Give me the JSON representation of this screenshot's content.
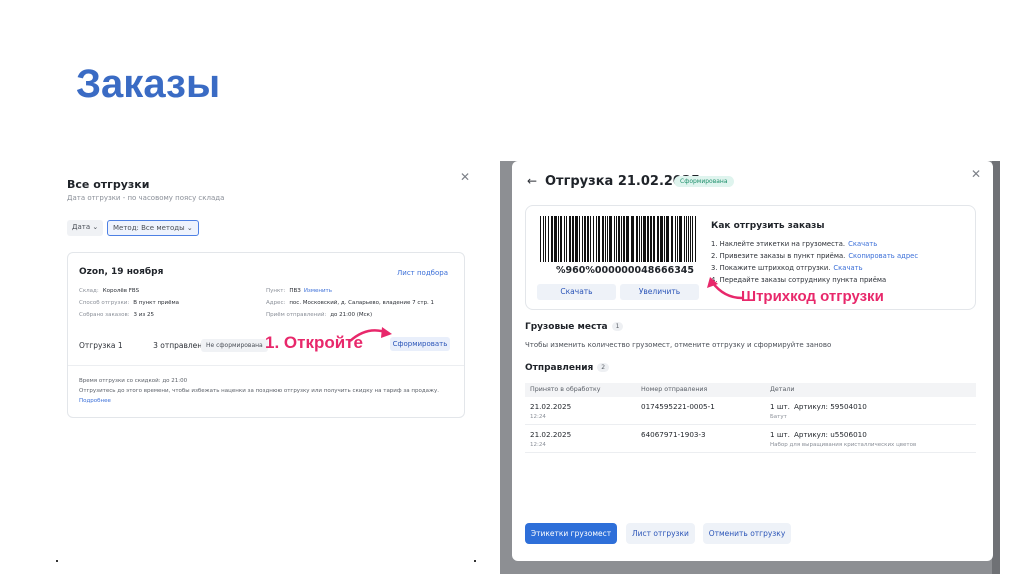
{
  "slide": {
    "title": "Заказы"
  },
  "left": {
    "title": "Все отгрузки",
    "subtitle": "Дата отгрузки - по часовому поясу склада",
    "close_icon": "close-icon",
    "filters": {
      "date": "Дата",
      "method": "Метод: Все методы"
    },
    "card": {
      "title": "Ozon, 19 ноября",
      "link": "Лист подбора",
      "warehouse_label": "Склад:",
      "warehouse_value": "Королёв FBS",
      "method_label": "Способ отгрузки:",
      "method_value": "В пункт приёма",
      "collected_label": "Собрано заказов:",
      "collected_value": "3 из 25",
      "point_label": "Пункт:",
      "point_value": "ПВЗ",
      "point_change": "Изменить",
      "address_label": "Адрес:",
      "address_value": "пос. Московский, д. Саларьево, владение 7 стр. 1",
      "receive_label": "Приём отправлений:",
      "receive_value": "до 21:00 (Мск)",
      "shipment_tab": "Отгрузка 1",
      "shipments_count": "3 отправления",
      "status_badge": "Не сформирована",
      "form_button": "Сформировать",
      "note1": "Время отгрузки со скидкой: до 21:00",
      "note2": "Отгрузитесь до этого времени, чтобы избежать наценки за позднюю отгрузку или получить скидку на тариф за продажу.",
      "more_link": "Подробнее"
    },
    "annotation": "1. Откройте"
  },
  "modal": {
    "title": "Отгрузка 21.02.2025",
    "status": "Сформирована",
    "barcode_number": "%960%000000048666345",
    "download_button": "Скачать",
    "zoom_button": "Увеличить",
    "how_title": "Как отгрузить заказы",
    "steps": [
      {
        "text": "1. Наклейте этикетки на грузоместа.",
        "link": "Скачать"
      },
      {
        "text": "2. Привезите заказы в пункт приёма.",
        "link": "Скопировать адрес"
      },
      {
        "text": "3. Покажите штрихкод отгрузки.",
        "link": "Скачать"
      },
      {
        "text": "4. Передайте заказы сотруднику пункта приёма",
        "link": ""
      }
    ],
    "annotation": "Штрихкод отгрузки",
    "cargo_title": "Грузовые места",
    "cargo_count": "1",
    "cargo_note": "Чтобы изменить количество грузомест, отмените отгрузку и сформируйте заново",
    "shipments_title": "Отправления",
    "shipments_count": "2",
    "table": {
      "headers": [
        "Принято в обработку",
        "Номер отправления",
        "Детали"
      ],
      "rows": [
        {
          "date": "21.02.2025",
          "time": "12:24",
          "number": "0174595221-0005-1",
          "qty": "1 шт.",
          "article": "Артикул: 59504010",
          "desc": "Батут"
        },
        {
          "date": "21.02.2025",
          "time": "12:24",
          "number": "64067971-1903-3",
          "qty": "1 шт.",
          "article": "Артикул: u5506010",
          "desc": "Набор для выращивания кристаллических цветов"
        }
      ]
    },
    "footer": {
      "labels_button": "Этикетки грузомест",
      "sheet_button": "Лист отгрузки",
      "cancel_button": "Отменить отгрузку"
    }
  },
  "colors": {
    "title_blue": "#3a6bc4",
    "annotation_pink": "#e8286b",
    "primary_blue": "#2e6fd9",
    "status_green": "#1e8f6b"
  }
}
